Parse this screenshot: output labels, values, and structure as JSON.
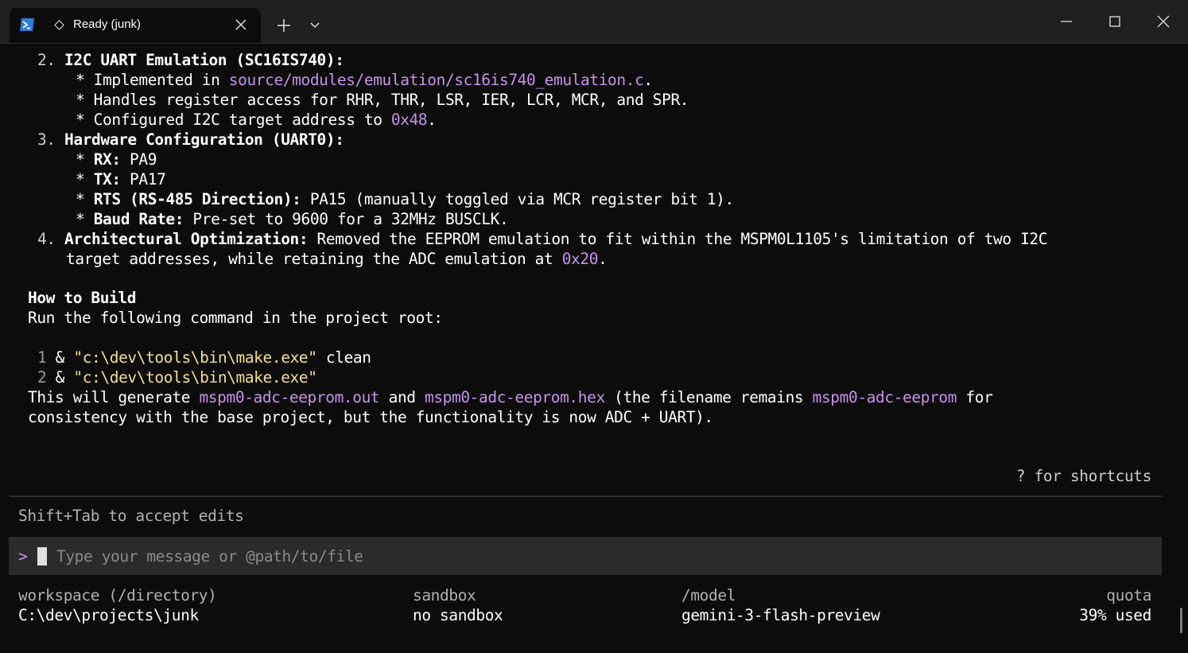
{
  "tab": {
    "title": "Ready (junk)",
    "icon": "powershell-icon",
    "state_icon": "diamond-icon"
  },
  "colors": {
    "background": "#0c0c0c",
    "titlebar": "#1f1f1f",
    "accent_purple": "#c792ea",
    "string_yellow": "#f2e08c",
    "error_pink": "#ff6b8b"
  },
  "content": {
    "item2": {
      "num": "2.",
      "title": "I2C UART Emulation (SC16IS740):",
      "b1_pre": "* Implemented in ",
      "b1_path": "source/modules/emulation/sc16is740_emulation.c",
      "b1_post": ".",
      "b2": "* Handles register access for RHR, THR, LSR, IER, LCR, MCR, and SPR.",
      "b3_pre": "* Configured I2C target address to ",
      "b3_addr": "0x48",
      "b3_post": "."
    },
    "item3": {
      "num": "3.",
      "title": "Hardware Configuration (UART0):",
      "rx_star": "* ",
      "rx_label": "RX:",
      "rx_value": " PA9",
      "tx_star": "* ",
      "tx_label": "TX:",
      "tx_value": " PA17",
      "rts_star": "* ",
      "rts_label": "RTS (RS-485 Direction):",
      "rts_value": " PA15 (manually toggled via MCR register bit 1).",
      "baud_star": "* ",
      "baud_label": "Baud Rate:",
      "baud_value": " Pre-set to 9600 for a 32MHz BUSCLK."
    },
    "item4": {
      "num": "4.",
      "label": "Architectural Optimization:",
      "text1": " Removed the EEPROM emulation to fit within the MSPM0L1105's limitation of two I2C",
      "text2_pre": "target addresses, while retaining the ADC emulation at ",
      "text2_addr": "0x20",
      "text2_post": "."
    },
    "build": {
      "heading": "How to Build",
      "intro": "Run the following command in the project root:",
      "cmd1_num": "1",
      "cmd1_amp": " & ",
      "cmd1_path": "\"c:\\dev\\tools\\bin\\make.exe\"",
      "cmd1_arg": " clean",
      "cmd2_num": "2",
      "cmd2_amp": " & ",
      "cmd2_path": "\"c:\\dev\\tools\\bin\\make.exe\"",
      "gen_pre": "This will generate ",
      "gen_file1": "mspm0-adc-eeprom.out",
      "gen_and": " and ",
      "gen_file2": "mspm0-adc-eeprom.hex",
      "gen_mid": " (the filename remains ",
      "gen_file3": "mspm0-adc-eeprom",
      "gen_post": " for",
      "gen_line2": "consistency with the base project, but the functionality is now ADC + UART)."
    }
  },
  "shortcuts_hint": "? for shortcuts",
  "edit_hint": "Shift+Tab to accept edits",
  "input": {
    "prompt": ">",
    "placeholder": "Type your message or @path/to/file"
  },
  "footer": {
    "workspace_label": "workspace (/directory)",
    "workspace_value": "C:\\dev\\projects\\junk",
    "sandbox_label": "sandbox",
    "sandbox_value": "no sandbox",
    "model_label": "/model",
    "model_value": "gemini-3-flash-preview",
    "quota_label": "quota",
    "quota_value": "39% used"
  }
}
